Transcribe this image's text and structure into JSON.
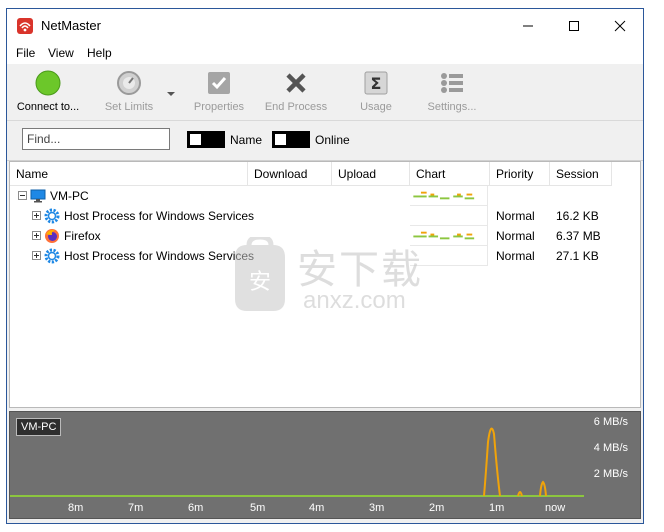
{
  "window": {
    "title": "NetMaster"
  },
  "menu": [
    "File",
    "View",
    "Help"
  ],
  "toolbar": {
    "connect": "Connect to...",
    "set_limits": "Set Limits",
    "properties": "Properties",
    "end_process": "End Process",
    "usage": "Usage",
    "settings": "Settings..."
  },
  "filter": {
    "find_placeholder": "Find...",
    "name_toggle_label": "Name",
    "online_toggle_label": "Online"
  },
  "table": {
    "columns": [
      "Name",
      "Download",
      "Upload",
      "Chart",
      "Priority",
      "Session"
    ],
    "rows": [
      {
        "name": "VM-PC",
        "priority": "",
        "session": "",
        "icon": "computer-icon"
      },
      {
        "name": "Host Process for Windows Services",
        "priority": "Normal",
        "session": "16.2 KB",
        "icon": "gear-icon"
      },
      {
        "name": "Firefox",
        "priority": "Normal",
        "session": "6.37 MB",
        "icon": "firefox-icon"
      },
      {
        "name": "Host Process for Windows Services",
        "priority": "Normal",
        "session": "27.1 KB",
        "icon": "gear-icon"
      }
    ]
  },
  "watermark": {
    "text": "安下载",
    "subtext": "anxz.com"
  },
  "graph": {
    "label": "VM-PC",
    "y_ticks": [
      "6 MB/s",
      "4 MB/s",
      "2 MB/s"
    ],
    "x_ticks": [
      "8m",
      "7m",
      "6m",
      "5m",
      "4m",
      "3m",
      "2m",
      "1m",
      "now"
    ]
  },
  "colors": {
    "accent_green": "#8cc63f",
    "orange": "#f0a30a",
    "graph_bg": "#707070"
  }
}
